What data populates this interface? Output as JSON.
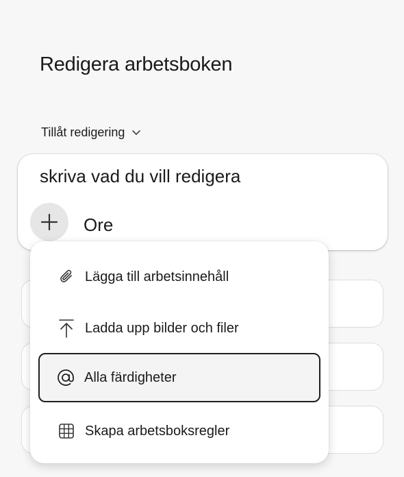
{
  "title": "Redigera arbetsboken",
  "permission": {
    "label": "Tillåt redigering"
  },
  "composer": {
    "input_value": "skriva vad du vill redigera",
    "more_label": "Ore"
  },
  "menu": {
    "items": [
      {
        "label": "Lägga till arbetsinnehåll",
        "icon": "paperclip-icon"
      },
      {
        "label": "Ladda upp bilder och filer",
        "icon": "upload-icon"
      },
      {
        "label": "Alla färdigheter",
        "icon": "at-sign-icon",
        "selected": true
      },
      {
        "label": "Skapa arbetsboksregler",
        "icon": "table-grid-icon"
      }
    ]
  }
}
